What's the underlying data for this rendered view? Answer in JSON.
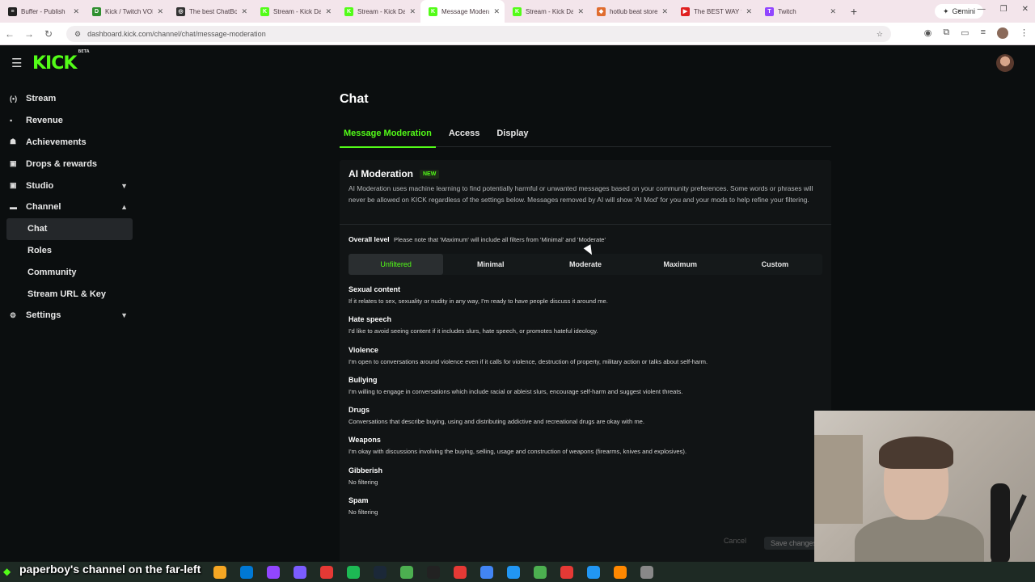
{
  "browser": {
    "tabs": [
      {
        "label": "Buffer - Publish",
        "color": "#222222",
        "glyph": "≡"
      },
      {
        "label": "Kick / Twitch VOD",
        "color": "#2f8f2f",
        "glyph": "D"
      },
      {
        "label": "The best ChatBot",
        "color": "#333333",
        "glyph": "◎"
      },
      {
        "label": "Stream - Kick Dash",
        "color": "#53fc18",
        "glyph": "K"
      },
      {
        "label": "Stream - Kick Dash",
        "color": "#53fc18",
        "glyph": "K"
      },
      {
        "label": "Message Moderation",
        "color": "#53fc18",
        "glyph": "K",
        "active": true
      },
      {
        "label": "Stream - Kick Dash",
        "color": "#53fc18",
        "glyph": "K"
      },
      {
        "label": "hotlub beat store",
        "color": "#e06d2f",
        "glyph": "◆"
      },
      {
        "label": "The BEST WAY to",
        "color": "#e02020",
        "glyph": "▶"
      },
      {
        "label": "Twitch",
        "color": "#9146ff",
        "glyph": "T"
      }
    ],
    "new_tab": "+",
    "gemini_label": "Gemini",
    "url": "dashboard.kick.com/channel/chat/message-moderation"
  },
  "app": {
    "logo": "KICK",
    "logo_sup": "BETA"
  },
  "sidebar": {
    "items": [
      {
        "label": "Stream",
        "icon": "(•)",
        "chevron": ""
      },
      {
        "label": "Revenue",
        "icon": "▪",
        "chevron": ""
      },
      {
        "label": "Achievements",
        "icon": "☗",
        "chevron": ""
      },
      {
        "label": "Drops & rewards",
        "icon": "▣",
        "chevron": ""
      },
      {
        "label": "Studio",
        "icon": "▣",
        "chevron": "▼"
      },
      {
        "label": "Channel",
        "icon": "▬",
        "chevron": "▲"
      },
      {
        "label": "Chat",
        "sub": true,
        "active": true
      },
      {
        "label": "Roles",
        "sub": true
      },
      {
        "label": "Community",
        "sub": true
      },
      {
        "label": "Stream URL & Key",
        "sub": true
      },
      {
        "label": "Settings",
        "icon": "⚙",
        "chevron": "▼"
      }
    ]
  },
  "main": {
    "title": "Chat",
    "tabs": [
      "Message Moderation",
      "Access",
      "Display"
    ],
    "ai": {
      "title": "AI Moderation",
      "badge": "NEW",
      "description": "AI Moderation uses machine learning to find potentially harmful or unwanted messages based on your community preferences. Some words or phrases will never be allowed on KICK regardless of the settings below. Messages removed by AI will show 'AI Mod' for you and your mods to help refine your filtering."
    },
    "overall": {
      "label": "Overall level",
      "note": "Please note that 'Maximum' will include all filters from 'Minimal' and 'Moderate'"
    },
    "levels": [
      "Unfiltered",
      "Minimal",
      "Moderate",
      "Maximum",
      "Custom"
    ],
    "selected_level": "Unfiltered",
    "categories": [
      {
        "title": "Sexual content",
        "desc": "If it relates to sex, sexuality or nudity in any way, I'm ready to have people discuss it around me."
      },
      {
        "title": "Hate speech",
        "desc": "I'd like to avoid seeing content if it includes slurs, hate speech, or promotes hateful ideology."
      },
      {
        "title": "Violence",
        "desc": "I'm open to conversations around violence even if it calls for violence, destruction of property, military action or talks about self-harm."
      },
      {
        "title": "Bullying",
        "desc": "I'm willing to engage in conversations which include racial or ableist slurs, encourage self-harm and suggest violent threats."
      },
      {
        "title": "Drugs",
        "desc": "Conversations that describe buying, using and distributing addictive and recreational drugs are okay with me."
      },
      {
        "title": "Weapons",
        "desc": "I'm okay with discussions involving the buying, selling, usage and construction of weapons (firearms, knives and explosives)."
      },
      {
        "title": "Gibberish",
        "desc": "No filtering"
      },
      {
        "title": "Spam",
        "desc": "No filtering"
      }
    ],
    "cancel_label": "Cancel",
    "save_label": "Save changes"
  },
  "overlay": {
    "caption": "paperboy's channel on the far-left"
  },
  "taskbar": {
    "apps": [
      "#f5a623",
      "#0078d4",
      "#9146ff",
      "#7b5cff",
      "#e53935",
      "#1db954",
      "#1b2838",
      "#4caf50",
      "#222222",
      "#e53935",
      "#4285f4",
      "#2196f3",
      "#4caf50",
      "#e53935",
      "#2196f3",
      "#ff8800",
      "#888888"
    ]
  },
  "colors": {
    "accent": "#53fc18",
    "background": "#0b0e0f"
  }
}
